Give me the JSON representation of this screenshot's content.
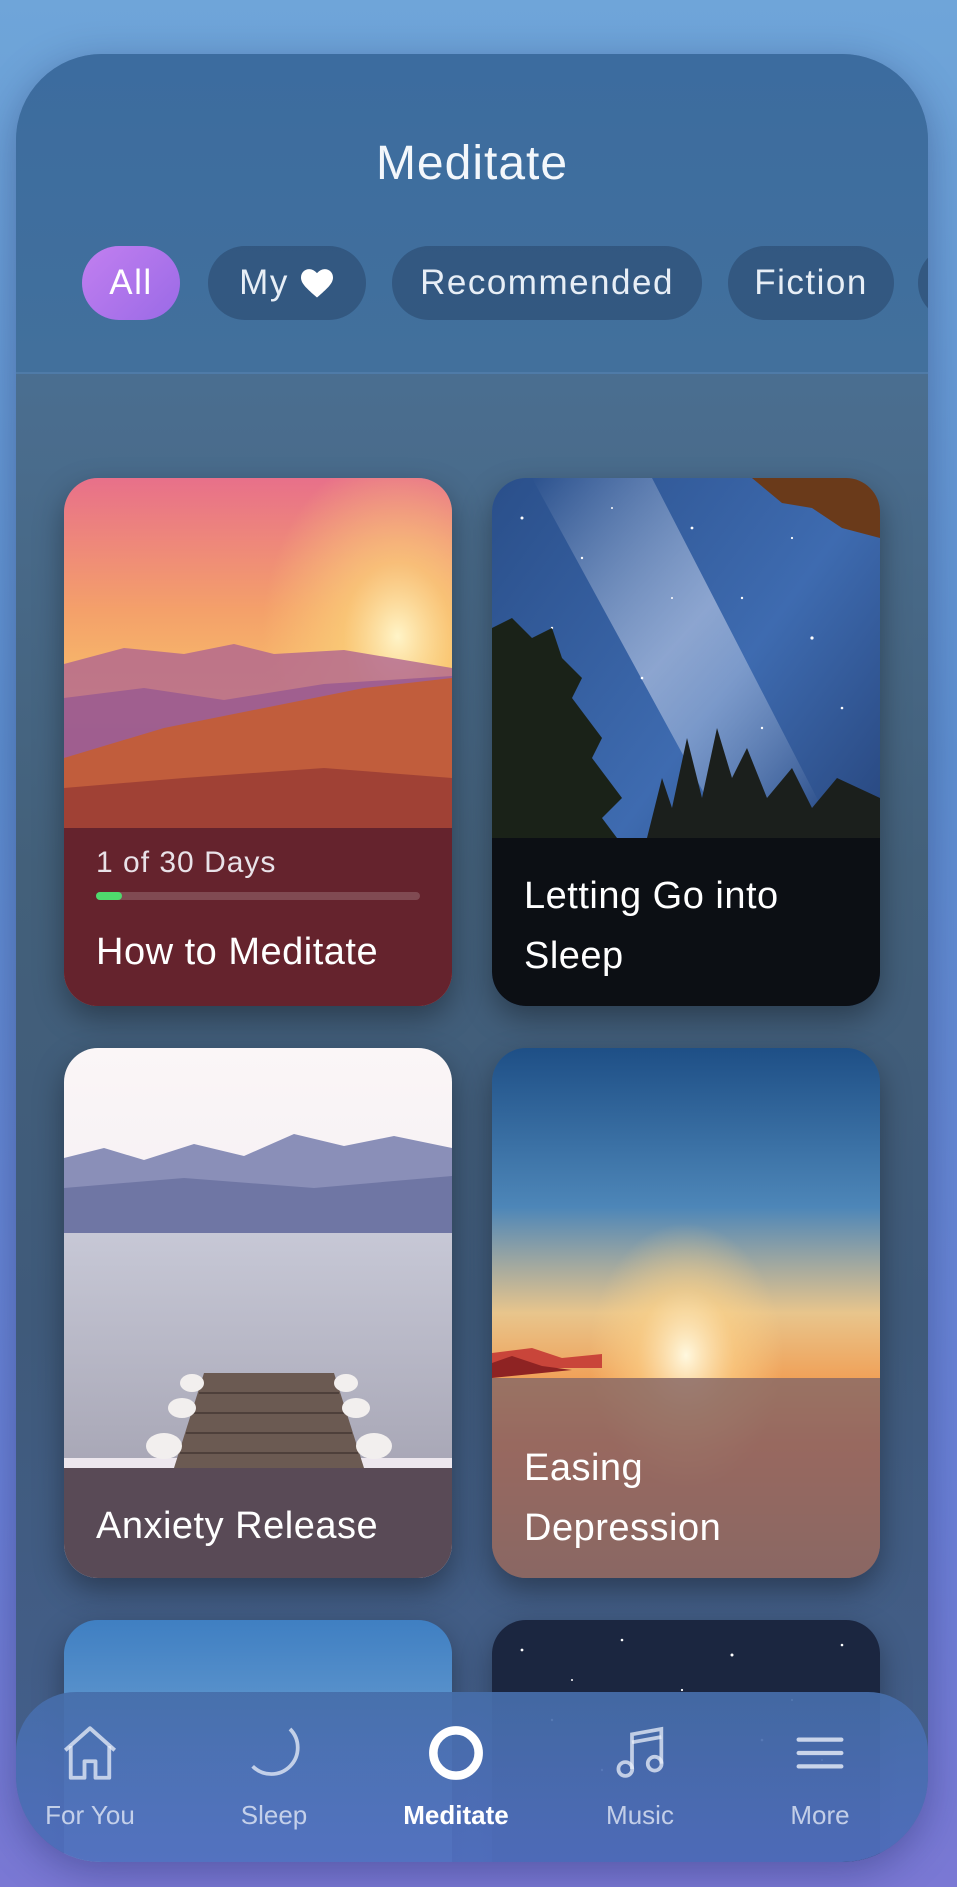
{
  "header": {
    "title": "Meditate"
  },
  "filters": [
    {
      "label": "All",
      "active": true
    },
    {
      "label": "My",
      "icon": "heart-icon"
    },
    {
      "label": "Recommended"
    },
    {
      "label": "Fiction"
    }
  ],
  "cards": [
    {
      "name": "How to Meditate",
      "progress_label": "1 of 30 Days",
      "progress": 0.08
    },
    {
      "name": "Letting Go into Sleep"
    },
    {
      "name": "Anxiety Release"
    },
    {
      "name": "Easing Depression"
    }
  ],
  "tabs": [
    {
      "label": "For You",
      "icon": "home-icon"
    },
    {
      "label": "Sleep",
      "icon": "moon-icon"
    },
    {
      "label": "Meditate",
      "icon": "circle-icon",
      "active": true
    },
    {
      "label": "Music",
      "icon": "music-note-icon"
    },
    {
      "label": "More",
      "icon": "menu-icon"
    }
  ],
  "colors": {
    "accent": "#b47bee",
    "progress": "#4fd96d"
  }
}
